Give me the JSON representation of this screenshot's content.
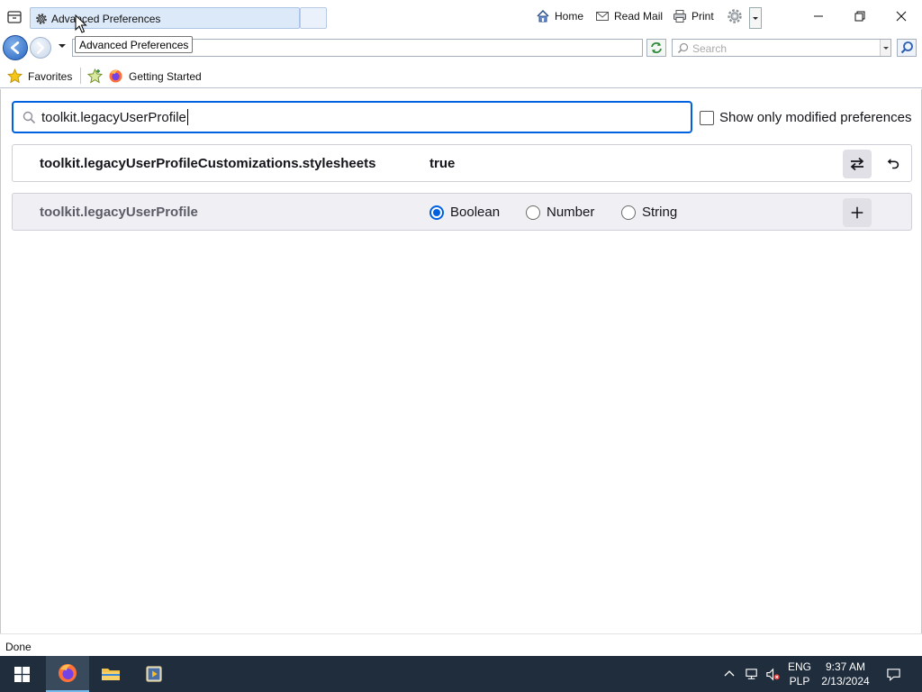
{
  "browser": {
    "tab_title": "Advanced Preferences",
    "tooltip": "Advanced Preferences",
    "commands": {
      "home": "Home",
      "read_mail": "Read Mail",
      "print": "Print"
    },
    "search_placeholder": "Search",
    "favorites": {
      "favorites_label": "Favorites",
      "getting_started": "Getting Started"
    },
    "status_text": "Done"
  },
  "prefs": {
    "filter_value": "toolkit.legacyUserProfile",
    "show_modified_label": "Show only modified preferences",
    "show_modified_checked": false,
    "rows": [
      {
        "name": "toolkit.legacyUserProfileCustomizations.stylesheets",
        "value": "true"
      }
    ],
    "new_pref": {
      "name": "toolkit.legacyUserProfile",
      "types": [
        "Boolean",
        "Number",
        "String"
      ],
      "selected_type": "Boolean"
    }
  },
  "taskbar": {
    "lang_top": "ENG",
    "lang_bottom": "PLP",
    "time": "9:37 AM",
    "date": "2/13/2024"
  },
  "colors": {
    "accent": "#0061e0",
    "taskbar": "#1f2d3d"
  }
}
